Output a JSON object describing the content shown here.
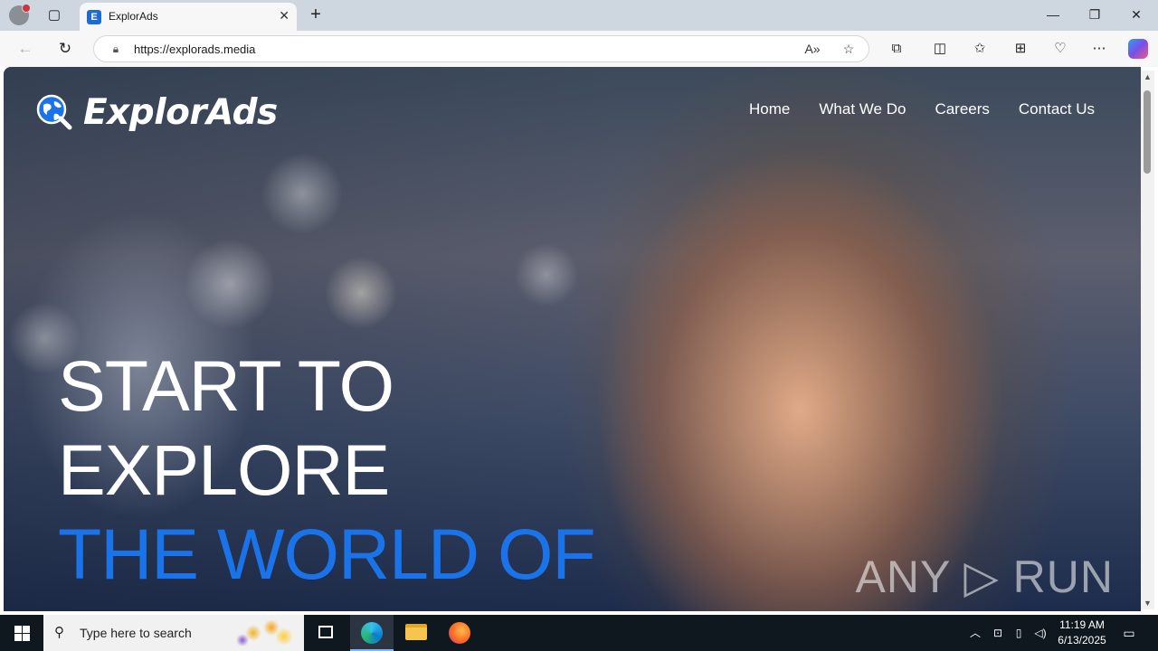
{
  "browser": {
    "tab_title": "ExplorAds",
    "tab_favicon_letter": "E",
    "url": "https://explorads.media"
  },
  "site": {
    "logo_text": "ExplorAds",
    "nav": [
      "Home",
      "What We Do",
      "Careers",
      "Contact Us"
    ],
    "headline": [
      "START TO",
      "EXPLORE",
      "THE WORLD OF"
    ],
    "accent_color": "#1a73e8",
    "watermark": "ANY ▷ RUN"
  },
  "taskbar": {
    "search_placeholder": "Type here to search",
    "time": "11:19 AM",
    "date": "6/13/2025"
  },
  "icons": {
    "browser": [
      "profile-icon",
      "tab-actions-icon",
      "close-icon",
      "new-tab-icon",
      "minimize-icon",
      "restore-icon",
      "window-close-icon",
      "back-icon",
      "refresh-icon",
      "lock-icon",
      "read-aloud-icon",
      "favorite-add-icon",
      "extensions-icon",
      "split-screen-icon",
      "favorites-icon",
      "collections-icon",
      "browser-essentials-icon",
      "more-icon",
      "copilot-icon"
    ],
    "taskbar": [
      "windows-start-icon",
      "search-icon",
      "task-view-icon",
      "edge-icon",
      "file-explorer-icon",
      "firefox-icon",
      "chevron-up-icon",
      "network-icon",
      "volume-icon",
      "notification-icon"
    ]
  }
}
